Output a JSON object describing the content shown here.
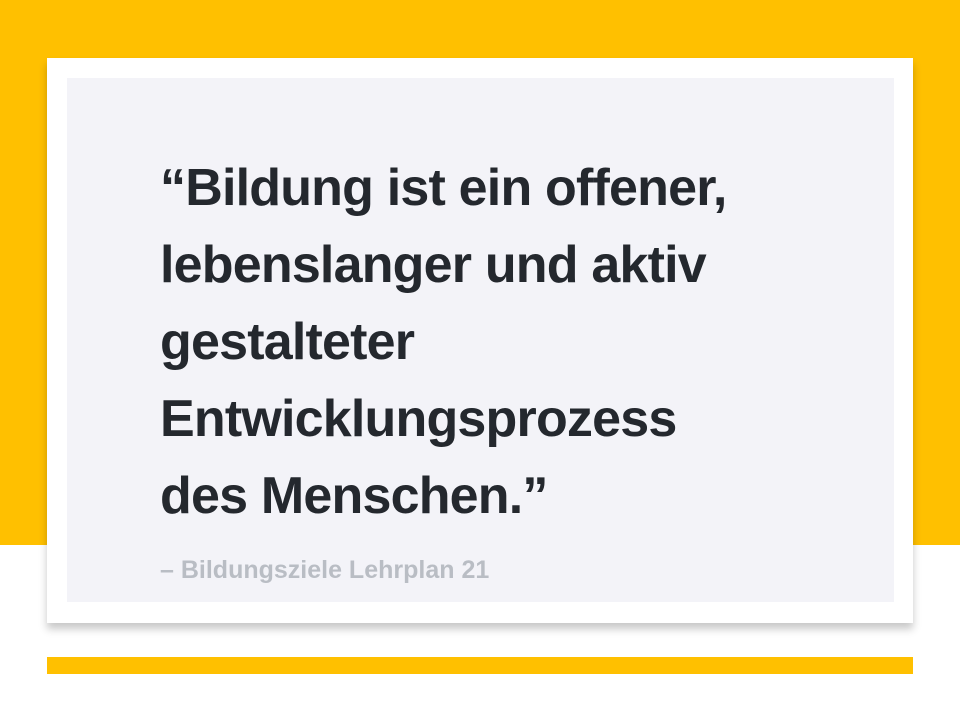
{
  "quote": {
    "text": "“Bildung ist ein offener,\nlebenslanger und aktiv\ngestalteter\nEntwicklungsprozess\ndes Menschen.”",
    "attribution": "– Bildungsziele Lehrplan 21"
  },
  "colors": {
    "accent": "#ffc000",
    "card_background": "#f3f3f8",
    "quote_text": "#24282e",
    "attribution_text": "#b9bdc4"
  }
}
